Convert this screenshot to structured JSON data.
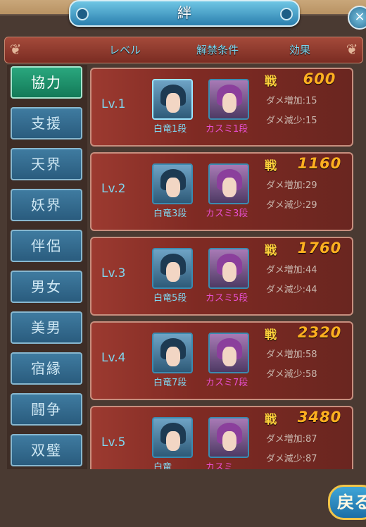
{
  "window": {
    "title": "絆",
    "close_icon": "close-icon"
  },
  "header": {
    "col_level": "レベル",
    "col_condition": "解禁条件",
    "col_effect": "効果"
  },
  "sidebar": {
    "items": [
      {
        "label": "協力",
        "active": true
      },
      {
        "label": "支援"
      },
      {
        "label": "天界"
      },
      {
        "label": "妖界"
      },
      {
        "label": "伴侶"
      },
      {
        "label": "男女"
      },
      {
        "label": "美男"
      },
      {
        "label": "宿縁"
      },
      {
        "label": "闘争"
      },
      {
        "label": "双璧"
      }
    ]
  },
  "levels": [
    {
      "level": "Lv.1",
      "char1": "白竜1段",
      "char2": "カスミ1段",
      "sen": "戦",
      "power": "600",
      "stat1": "ダメ増加:15",
      "stat2": "ダメ減少:15"
    },
    {
      "level": "Lv.2",
      "char1": "白竜3段",
      "char2": "カスミ3段",
      "sen": "戦",
      "power": "1160",
      "stat1": "ダメ増加:29",
      "stat2": "ダメ減少:29"
    },
    {
      "level": "Lv.3",
      "char1": "白竜5段",
      "char2": "カスミ5段",
      "sen": "戦",
      "power": "1760",
      "stat1": "ダメ増加:44",
      "stat2": "ダメ減少:44"
    },
    {
      "level": "Lv.4",
      "char1": "白竜7段",
      "char2": "カスミ7段",
      "sen": "戦",
      "power": "2320",
      "stat1": "ダメ増加:58",
      "stat2": "ダメ減少:58"
    },
    {
      "level": "Lv.5",
      "char1": "白竜",
      "char2": "カスミ",
      "sen": "戦",
      "power": "3480",
      "stat1": "ダメ増加:87",
      "stat2": "ダメ減少:87"
    }
  ],
  "footer": {
    "back_label": "戻る"
  }
}
